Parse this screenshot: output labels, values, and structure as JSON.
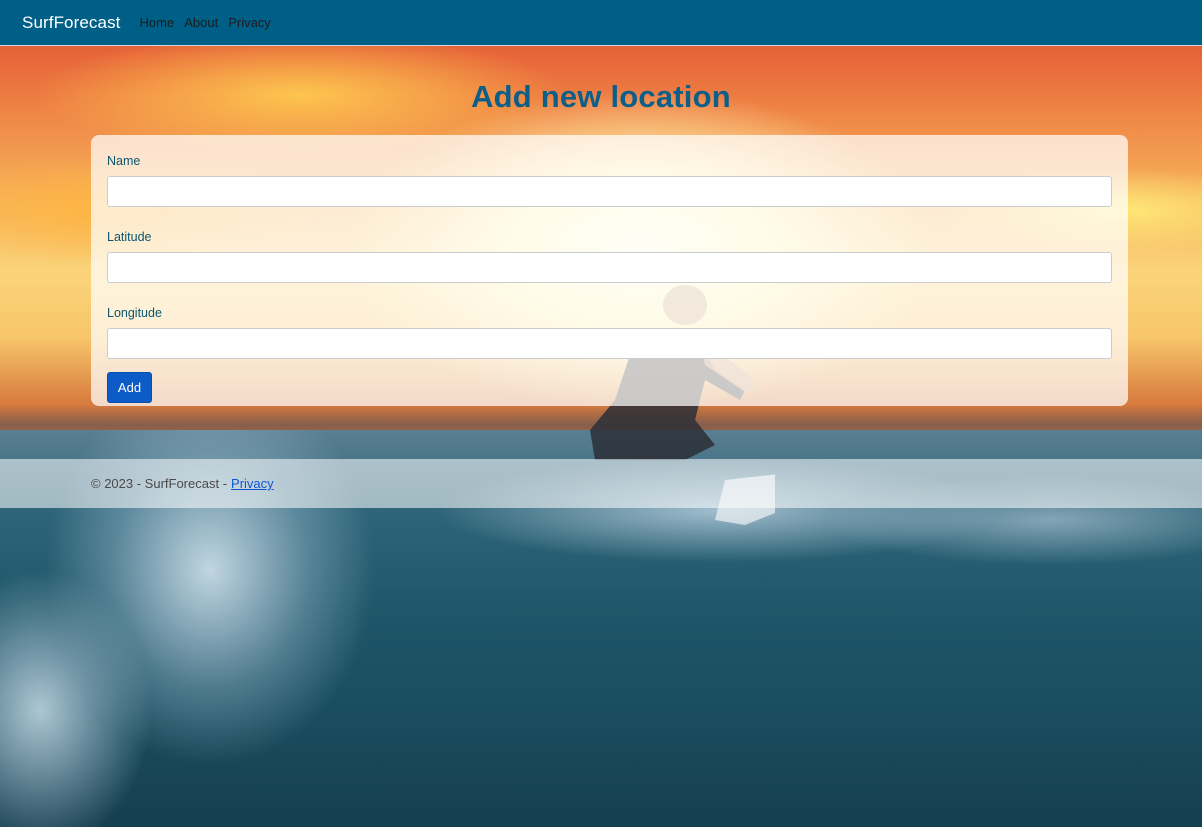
{
  "navbar": {
    "brand": "SurfForecast",
    "links": [
      "Home",
      "About",
      "Privacy"
    ]
  },
  "page": {
    "title": "Add new location"
  },
  "form": {
    "fields": [
      {
        "label": "Name",
        "value": "",
        "placeholder": ""
      },
      {
        "label": "Latitude",
        "value": "",
        "placeholder": ""
      },
      {
        "label": "Longitude",
        "value": "",
        "placeholder": ""
      }
    ],
    "submit_label": "Add"
  },
  "footer": {
    "text": "© 2023 - SurfForecast -",
    "link_label": "Privacy"
  },
  "colors": {
    "navbar_bg": "#005f87",
    "title": "#0e5f88",
    "label": "#0c5670",
    "button": "#0d5bc6",
    "link": "#0d57d6"
  },
  "background_image": "surfer riding a wave at sunset"
}
